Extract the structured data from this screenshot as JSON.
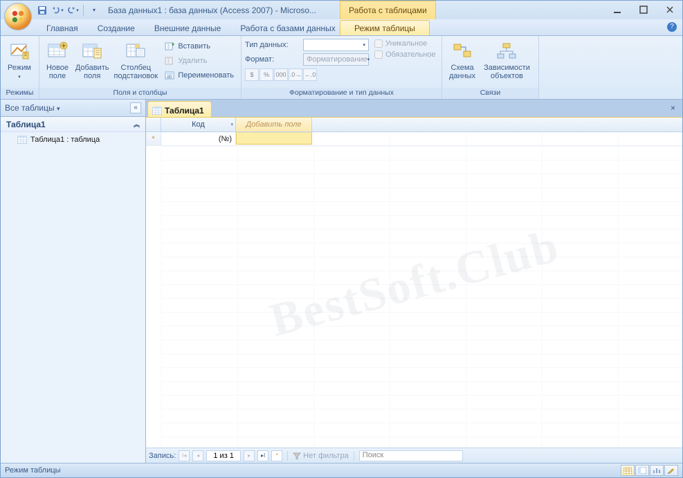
{
  "title": "База данных1 : база данных (Access 2007) - Microso...",
  "context_tab_title": "Работа с таблицами",
  "tabs": {
    "home": "Главная",
    "create": "Создание",
    "external": "Внешние данные",
    "dbtools": "Работа с базами данных",
    "datasheet": "Режим таблицы"
  },
  "ribbon": {
    "views": {
      "view": "Режим",
      "group": "Режимы"
    },
    "fields": {
      "new_field": "Новое\nполе",
      "add_fields": "Добавить\nполя",
      "lookup": "Столбец\nподстановок",
      "insert": "Вставить",
      "delete": "Удалить",
      "rename": "Переименовать",
      "group": "Поля и столбцы"
    },
    "format": {
      "datatype_lbl": "Тип данных:",
      "datatype_val": "",
      "format_lbl": "Формат:",
      "format_val": "Форматирование",
      "unique": "Уникальное",
      "required": "Обязательное",
      "group": "Форматирование и тип данных"
    },
    "rel": {
      "schema": "Схема\nданных",
      "deps": "Зависимости\nобъектов",
      "group": "Связи"
    }
  },
  "nav": {
    "header": "Все таблицы",
    "group": "Таблица1",
    "item": "Таблица1 : таблица"
  },
  "doc": {
    "tab": "Таблица1",
    "col_id": "Код",
    "col_add": "Добавить поле",
    "newrow_val": "(№)"
  },
  "recordbar": {
    "label": "Запись:",
    "pos": "1 из 1",
    "nofilter": "Нет фильтра",
    "search": "Поиск"
  },
  "status": "Режим таблицы",
  "watermark": "BestSoft.Club"
}
